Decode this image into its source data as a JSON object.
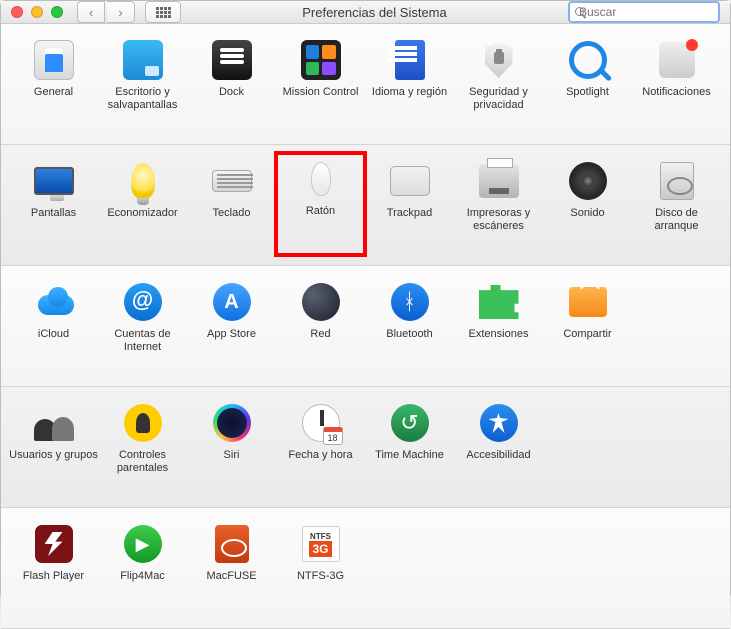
{
  "window_title": "Preferencias del Sistema",
  "search_placeholder": "Buscar",
  "highlighted": "raton",
  "calendar_day": "18",
  "rows": [
    {
      "alt": false,
      "items": [
        {
          "id": "general",
          "label": "General"
        },
        {
          "id": "escritorio",
          "label": "Escritorio y salvapantallas"
        },
        {
          "id": "dock",
          "label": "Dock"
        },
        {
          "id": "mission",
          "label": "Mission Control"
        },
        {
          "id": "idioma",
          "label": "Idioma y región"
        },
        {
          "id": "seguridad",
          "label": "Seguridad y privacidad"
        },
        {
          "id": "spotlight",
          "label": "Spotlight"
        },
        {
          "id": "notificaciones",
          "label": "Notificaciones"
        }
      ]
    },
    {
      "alt": true,
      "items": [
        {
          "id": "pantallas",
          "label": "Pantallas"
        },
        {
          "id": "economizador",
          "label": "Economizador"
        },
        {
          "id": "teclado",
          "label": "Teclado"
        },
        {
          "id": "raton",
          "label": "Ratón"
        },
        {
          "id": "trackpad",
          "label": "Trackpad"
        },
        {
          "id": "impresoras",
          "label": "Impresoras y escáneres"
        },
        {
          "id": "sonido",
          "label": "Sonido"
        },
        {
          "id": "disco",
          "label": "Disco de arranque"
        }
      ]
    },
    {
      "alt": false,
      "items": [
        {
          "id": "icloud",
          "label": "iCloud"
        },
        {
          "id": "cuentas",
          "label": "Cuentas de Internet"
        },
        {
          "id": "appstore",
          "label": "App Store"
        },
        {
          "id": "red",
          "label": "Red"
        },
        {
          "id": "bluetooth",
          "label": "Bluetooth"
        },
        {
          "id": "extensiones",
          "label": "Extensiones"
        },
        {
          "id": "compartir",
          "label": "Compartir"
        }
      ]
    },
    {
      "alt": true,
      "items": [
        {
          "id": "usuarios",
          "label": "Usuarios y grupos"
        },
        {
          "id": "parentales",
          "label": "Controles parentales"
        },
        {
          "id": "siri",
          "label": "Siri"
        },
        {
          "id": "fecha",
          "label": "Fecha y hora"
        },
        {
          "id": "timemachine",
          "label": "Time Machine"
        },
        {
          "id": "accesibilidad",
          "label": "Accesibilidad"
        }
      ]
    },
    {
      "alt": false,
      "items": [
        {
          "id": "flashplayer",
          "label": "Flash Player"
        },
        {
          "id": "flip4mac",
          "label": "Flip4Mac"
        },
        {
          "id": "macfuse",
          "label": "MacFUSE"
        },
        {
          "id": "ntfs3g",
          "label": "NTFS-3G"
        }
      ]
    }
  ]
}
